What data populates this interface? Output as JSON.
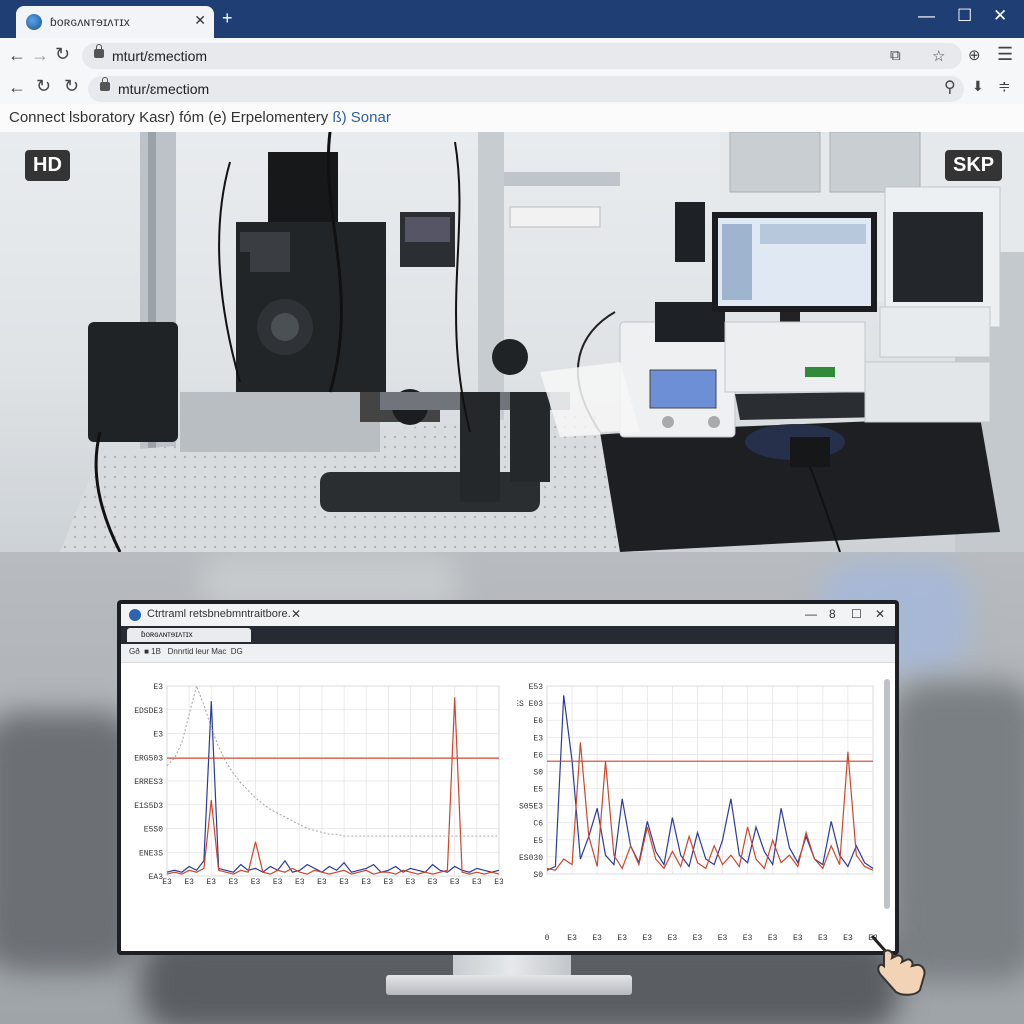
{
  "browser": {
    "tab_title": "ɓoʀɢʌɴтɘɪʌтɪx",
    "new_tab_label": "+",
    "window_controls": [
      "—",
      "☐",
      "✕"
    ],
    "url_primary": "mturt/ɛmectiom",
    "url_secondary": "mtur/ɛmectiom",
    "breadcrumb_main": "Connect lsboratory Kasr) fóm (e) Erpelomentery",
    "breadcrumb_accent": "ß) Sonar"
  },
  "badges": {
    "left": "HD",
    "right": "SKP"
  },
  "monitor": {
    "window_title": "Ctrtraml retsbnebmntraitbore.",
    "tab_label": "ɓoʀɢʌɴтɘɪʌтɪx",
    "nav_text": "Gð  ■ 1B   Dnnrtid leur Mac  DG",
    "window_controls": [
      "—",
      "8",
      "☐",
      "✕"
    ]
  },
  "chart_data": [
    {
      "type": "line",
      "y_tick_labels": [
        "E3",
        "EDSDE3",
        "E3",
        "ERG503",
        "ERRES3",
        "E1S5D3",
        "E5S0",
        "ENE3S",
        "EA3"
      ],
      "x_tick_labels": [
        "E3",
        "E3",
        "E3",
        "E3",
        "E3",
        "E3",
        "E3",
        "E3",
        "E3",
        "E3",
        "E3",
        "E3",
        "E3",
        "E3",
        "E3",
        "E3"
      ],
      "grid": true,
      "series": [
        {
          "color": "#2b3b9a",
          "values": [
            2,
            3,
            2,
            5,
            3,
            8,
            92,
            4,
            3,
            2,
            6,
            3,
            4,
            2,
            5,
            3,
            8,
            2,
            3,
            6,
            4,
            2,
            5,
            3,
            7,
            2,
            3,
            4,
            6,
            2,
            3,
            5,
            2,
            4,
            3,
            2,
            6,
            3,
            2,
            5,
            3,
            2,
            4,
            3,
            2,
            3
          ]
        },
        {
          "color": "#d0452b",
          "values": [
            1,
            2,
            1,
            3,
            2,
            4,
            40,
            3,
            2,
            1,
            3,
            2,
            18,
            2,
            1,
            3,
            2,
            4,
            2,
            1,
            3,
            2,
            1,
            2,
            3,
            1,
            2,
            3,
            1,
            2,
            2,
            1,
            3,
            2,
            1,
            2,
            1,
            2,
            3,
            94,
            2,
            1,
            2,
            1,
            2,
            1
          ]
        },
        {
          "color": "#d0452b",
          "values": [
            62,
            62,
            62,
            62,
            62,
            62,
            62,
            62,
            62,
            62,
            62,
            62,
            62,
            62,
            62,
            62,
            62,
            62,
            62,
            62,
            62,
            62,
            62,
            62,
            62,
            62,
            62,
            62,
            62,
            62,
            62,
            62,
            62,
            62,
            62,
            62,
            62,
            62,
            62,
            62,
            62,
            62,
            62,
            62,
            62,
            62
          ]
        },
        {
          "color": "#9a9a9a",
          "values": [
            58,
            62,
            70,
            85,
            100,
            90,
            78,
            68,
            60,
            54,
            49,
            45,
            41,
            38,
            35,
            33,
            31,
            29,
            27,
            25,
            24,
            23,
            22,
            22,
            21,
            21,
            21,
            21,
            21,
            21,
            21,
            21,
            21,
            21,
            21,
            21,
            21,
            21,
            21,
            21,
            21,
            21,
            21,
            21,
            21,
            21
          ]
        }
      ]
    },
    {
      "type": "line",
      "y_tick_labels": [
        "E53",
        "ES E03",
        "E6",
        "E3",
        "E6",
        "S0",
        "E5",
        "S05E3",
        "C6",
        "E5",
        "ES030",
        "S0"
      ],
      "x_tick_labels": [
        "0",
        "E3",
        "E3",
        "E3",
        "E3",
        "E3",
        "E3",
        "E3",
        "E3",
        "E3",
        "E3",
        "E3",
        "E3",
        "E3"
      ],
      "grid": true,
      "series": [
        {
          "color": "#2b3b9a",
          "values": [
            2,
            4,
            95,
            60,
            8,
            20,
            35,
            10,
            5,
            40,
            15,
            6,
            28,
            12,
            5,
            30,
            10,
            4,
            22,
            8,
            5,
            18,
            40,
            10,
            6,
            25,
            12,
            5,
            35,
            14,
            6,
            20,
            8,
            5,
            28,
            10,
            4,
            15,
            6,
            3
          ]
        },
        {
          "color": "#d0452b",
          "values": [
            3,
            2,
            8,
            5,
            70,
            20,
            4,
            60,
            10,
            3,
            15,
            5,
            25,
            8,
            3,
            12,
            4,
            20,
            6,
            3,
            15,
            5,
            10,
            4,
            25,
            8,
            3,
            18,
            6,
            10,
            4,
            22,
            8,
            3,
            15,
            5,
            65,
            10,
            4,
            2
          ]
        },
        {
          "color": "#d0452b",
          "values": [
            60,
            60,
            60,
            60,
            60,
            60,
            60,
            60,
            60,
            60,
            60,
            60,
            60,
            60,
            60,
            60,
            60,
            60,
            60,
            60,
            60,
            60,
            60,
            60,
            60,
            60,
            60,
            60,
            60,
            60,
            60,
            60,
            60,
            60,
            60,
            60,
            60,
            60,
            60,
            60
          ]
        }
      ]
    }
  ]
}
